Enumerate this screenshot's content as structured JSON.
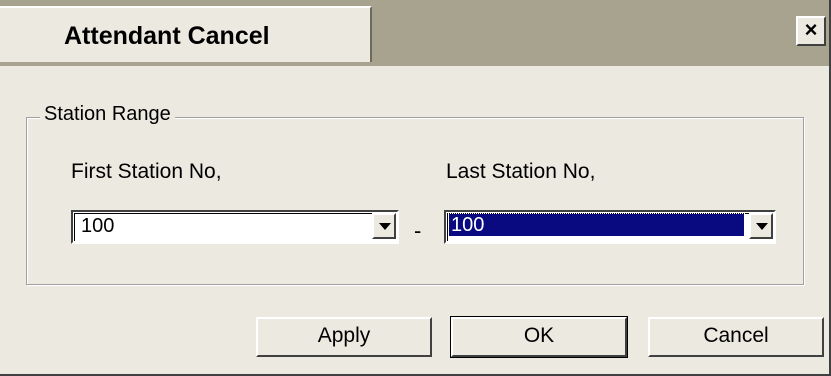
{
  "window": {
    "title": "Attendant Cancel",
    "close_label": "×"
  },
  "station_range": {
    "group_label": "Station Range",
    "first": {
      "label": "First Station No,",
      "value": "100"
    },
    "separator": "-",
    "last": {
      "label": "Last Station No,",
      "value": "100"
    }
  },
  "buttons": {
    "apply": "Apply",
    "ok": "OK",
    "cancel": "Cancel"
  }
}
